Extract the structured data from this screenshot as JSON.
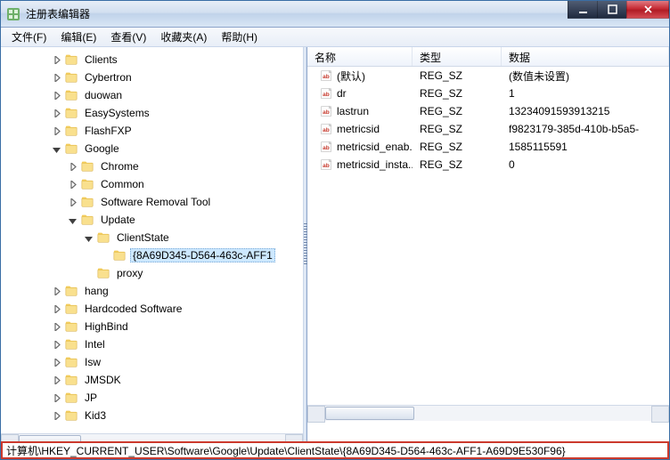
{
  "window": {
    "title": "注册表编辑器"
  },
  "menu": {
    "file": "文件(F)",
    "edit": "编辑(E)",
    "view": "查看(V)",
    "favorites": "收藏夹(A)",
    "help": "帮助(H)"
  },
  "tree": {
    "nodes": [
      {
        "level": 3,
        "toggle": "right",
        "label": "Clients"
      },
      {
        "level": 3,
        "toggle": "right",
        "label": "Cybertron"
      },
      {
        "level": 3,
        "toggle": "right",
        "label": "duowan"
      },
      {
        "level": 3,
        "toggle": "right",
        "label": "EasySystems"
      },
      {
        "level": 3,
        "toggle": "right",
        "label": "FlashFXP"
      },
      {
        "level": 3,
        "toggle": "down",
        "label": "Google"
      },
      {
        "level": 4,
        "toggle": "right",
        "label": "Chrome"
      },
      {
        "level": 4,
        "toggle": "right",
        "label": "Common"
      },
      {
        "level": 4,
        "toggle": "right",
        "label": "Software Removal Tool"
      },
      {
        "level": 4,
        "toggle": "down",
        "label": "Update"
      },
      {
        "level": 5,
        "toggle": "down",
        "label": "ClientState"
      },
      {
        "level": 6,
        "toggle": "none",
        "label": "{8A69D345-D564-463c-AFF1",
        "selected": true
      },
      {
        "level": 5,
        "toggle": "none",
        "label": "proxy"
      },
      {
        "level": 3,
        "toggle": "right",
        "label": "hang"
      },
      {
        "level": 3,
        "toggle": "right",
        "label": "Hardcoded Software"
      },
      {
        "level": 3,
        "toggle": "right",
        "label": "HighBind"
      },
      {
        "level": 3,
        "toggle": "right",
        "label": "Intel"
      },
      {
        "level": 3,
        "toggle": "right",
        "label": "Isw"
      },
      {
        "level": 3,
        "toggle": "right",
        "label": "JMSDK"
      },
      {
        "level": 3,
        "toggle": "right",
        "label": "JP"
      },
      {
        "level": 3,
        "toggle": "right",
        "label": "Kid3"
      }
    ]
  },
  "list": {
    "headers": {
      "name": "名称",
      "type": "类型",
      "data": "数据"
    },
    "rows": [
      {
        "name": "(默认)",
        "type": "REG_SZ",
        "data": "(数值未设置)"
      },
      {
        "name": "dr",
        "type": "REG_SZ",
        "data": "1"
      },
      {
        "name": "lastrun",
        "type": "REG_SZ",
        "data": "13234091593913215"
      },
      {
        "name": "metricsid",
        "type": "REG_SZ",
        "data": "f9823179-385d-410b-b5a5-"
      },
      {
        "name": "metricsid_enab...",
        "type": "REG_SZ",
        "data": "1585115591"
      },
      {
        "name": "metricsid_insta...",
        "type": "REG_SZ",
        "data": "0"
      }
    ]
  },
  "status": {
    "path": "计算机\\HKEY_CURRENT_USER\\Software\\Google\\Update\\ClientState\\{8A69D345-D564-463c-AFF1-A69D9E530F96}"
  }
}
